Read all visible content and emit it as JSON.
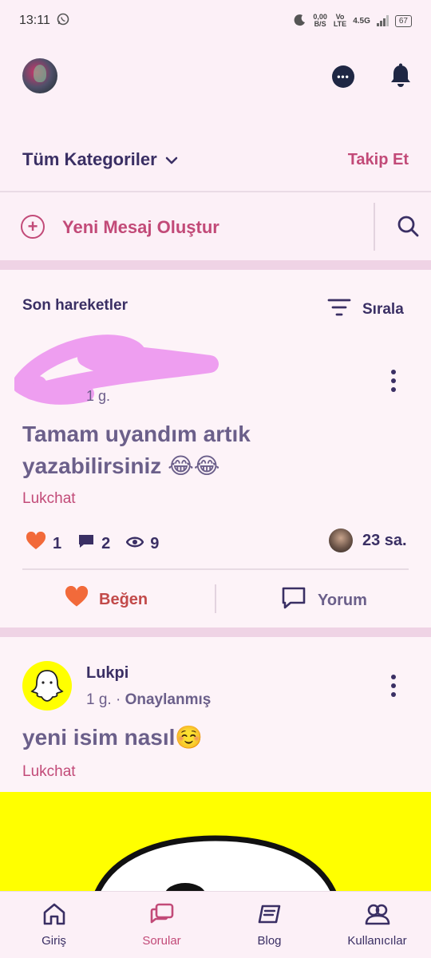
{
  "status_bar": {
    "time": "13:11",
    "net_speed_value": "0,00",
    "net_speed_unit": "B/S",
    "volte_top": "Vo",
    "volte_bottom": "LTE",
    "network": "4.5G",
    "battery": "67"
  },
  "header": {
    "category_label": "Tüm Kategoriler",
    "follow_label": "Takip Et"
  },
  "new_message": {
    "label": "Yeni Mesaj Oluştur"
  },
  "feed": {
    "section_title": "Son hareketler",
    "sort_label": "Sırala",
    "post1": {
      "time": "1 g.",
      "title_line1": "Tamam uyandım artık",
      "title_line2": "yazabilirsiniz 😂😂",
      "category": "Lukchat",
      "likes": "1",
      "comments": "2",
      "views": "9",
      "last_activity": "23 sa.",
      "like_label": "Beğen",
      "comment_label": "Yorum"
    },
    "post2": {
      "author": "Lukpi",
      "time": "1 g.",
      "badge": "Onaylanmış",
      "separator": "·",
      "title": "yeni isim nasıl☺️",
      "category": "Lukchat"
    }
  },
  "bottom_nav": {
    "items": [
      {
        "label": "Giriş",
        "icon": "home-icon"
      },
      {
        "label": "Sorular",
        "icon": "questions-icon",
        "active": true
      },
      {
        "label": "Blog",
        "icon": "blog-icon"
      },
      {
        "label": "Kullanıcılar",
        "icon": "users-icon"
      }
    ]
  },
  "colors": {
    "background": "#fcf0f7",
    "primary_text": "#3a2f64",
    "accent": "#c24a78",
    "like": "#f26a3a",
    "snap_yellow": "#ffff00"
  }
}
